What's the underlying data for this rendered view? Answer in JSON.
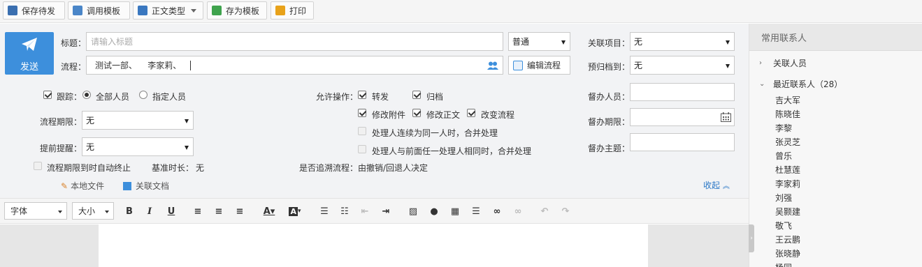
{
  "toolbar": {
    "save_draft": "保存待发",
    "call_template": "调用模板",
    "body_type": "正文类型",
    "save_template": "存为模板",
    "print": "打印"
  },
  "form": {
    "send": "发送",
    "title_label": "标题：",
    "title_placeholder": "请输入标题",
    "priority": "普通",
    "related_project_label": "关联项目：",
    "related_project_value": "无",
    "flow_label": "流程：",
    "flow_value": "测试一部、    李家莉、",
    "edit_flow": "编辑流程",
    "archive_label": "预归档到：",
    "archive_value": "无",
    "track_label": "跟踪：",
    "track_all": "全部人员",
    "track_specific": "指定人员",
    "allow_ops_label": "允许操作：",
    "op_forward": "转发",
    "op_archive": "归档",
    "op_modify_attach": "修改附件",
    "op_modify_body": "修改正文",
    "op_change_flow": "改变流程",
    "merge_same": "处理人连续为同一人时，合并处理",
    "merge_prev": "处理人与前面任一处理人相同时，合并处理",
    "supervisor_label": "督办人员：",
    "deadline_label": "督办期限：",
    "subject_label": "督办主题：",
    "flow_deadline_label": "流程期限：",
    "flow_deadline_value": "无",
    "reminder_label": "提前提醒：",
    "reminder_value": "无",
    "auto_end": "流程期限到时自动终止",
    "base_duration_label": "基准时长：",
    "base_duration_value": "无",
    "trace_label": "是否追溯流程：由撤销/回退人决定",
    "local_file": "本地文件",
    "related_doc": "关联文档",
    "collapse": "收起"
  },
  "editor": {
    "font": "字体",
    "size": "大小"
  },
  "contacts": {
    "title": "常用联系人",
    "group_related": "关联人员",
    "group_recent": "最近联系人（28）",
    "people": [
      "吉大军",
      "陈晓佳",
      "李黎",
      "张灵芝",
      "曾乐",
      "杜慧莲",
      "李家莉",
      "刘强",
      "吴颢建",
      "敬飞",
      "王云鹏",
      "张晓静",
      "杨同"
    ]
  },
  "colors": {
    "accent": "#3d8fdc",
    "link": "#2a77c6"
  }
}
